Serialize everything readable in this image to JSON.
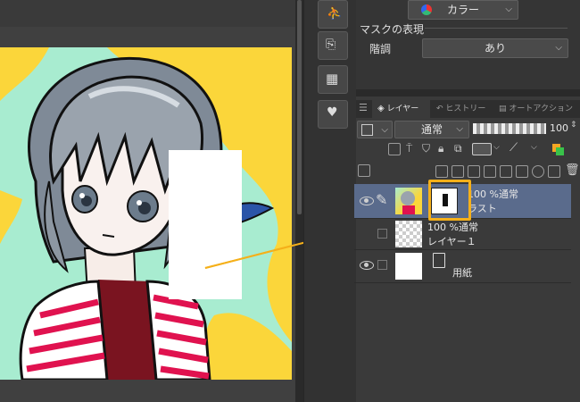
{
  "properties": {
    "color_dropdown": "カラー",
    "mask_section_title": "マスクの表現",
    "gradation_label": "階調",
    "gradation_value": "あり"
  },
  "layer_panel": {
    "tabs": [
      {
        "label": "レイヤー",
        "active": true
      },
      {
        "label": "ヒストリー",
        "active": false
      },
      {
        "label": "オートアクション",
        "active": false
      }
    ],
    "blend_mode": "通常",
    "opacity": "100"
  },
  "layers": [
    {
      "opacity_mode": "100 %通常",
      "name": "ラスト",
      "selected": true,
      "visible": true
    },
    {
      "opacity_mode": "100 %通常",
      "name": "レイヤー１",
      "selected": false,
      "visible": false
    },
    {
      "opacity_mode": "",
      "name": "用紙",
      "selected": false,
      "visible": true
    }
  ],
  "colors": {
    "accent": "#f5b01a",
    "selected_row": "#5a6b8c",
    "canvas_bg": "#a8ecd0",
    "canvas_yellow": "#fbd63a"
  }
}
